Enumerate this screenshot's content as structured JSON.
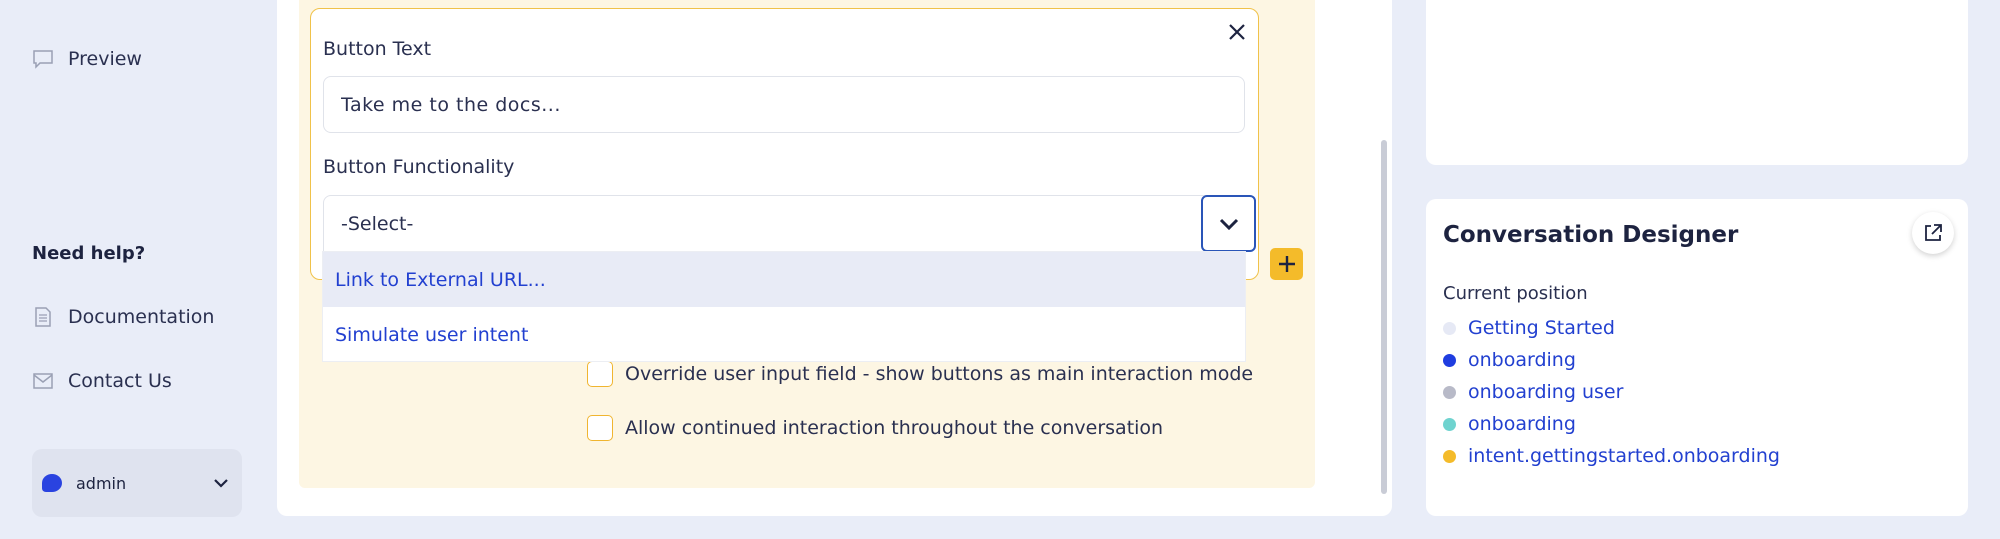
{
  "sidebar": {
    "preview_label": "Preview",
    "help_title": "Need help?",
    "documentation_label": "Documentation",
    "contact_label": "Contact Us",
    "user_name": "admin"
  },
  "editor": {
    "button_text_label": "Button Text",
    "button_text_value": "Take me to the docs...",
    "button_functionality_label": "Button Functionality",
    "select_value": "-Select-",
    "dropdown_options": [
      "Link to External URL...",
      "Simulate user intent"
    ]
  },
  "options": {
    "override_label": "Override user input field - show buttons as main interaction mode",
    "allow_label": "Allow continued interaction throughout the conversation"
  },
  "designer": {
    "title": "Conversation Designer",
    "subtitle": "Current position",
    "items": [
      {
        "label": "Getting Started",
        "color": "#e6e9f5"
      },
      {
        "label": "onboarding",
        "color": "#1f3de0"
      },
      {
        "label": "onboarding user",
        "color": "#b8bac8"
      },
      {
        "label": "onboarding",
        "color": "#6fd3cf"
      },
      {
        "label": "intent.gettingstarted.onboarding",
        "color": "#f4bb2a"
      }
    ]
  },
  "colors": {
    "accent_yellow": "#f4bb2a",
    "link_blue": "#2240d0",
    "panel_yellow": "#fdf6e3"
  }
}
